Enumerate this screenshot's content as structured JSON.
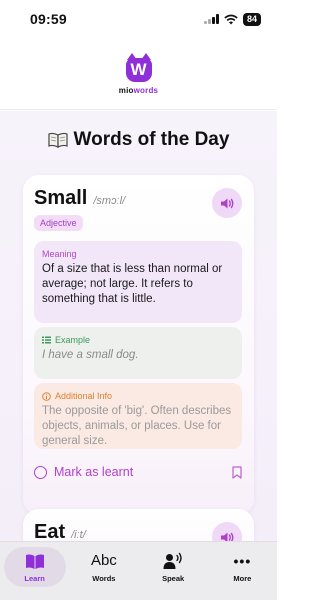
{
  "status": {
    "time": "09:59",
    "battery": "84"
  },
  "header": {
    "logo_letter": "W",
    "logo_prefix": "mio",
    "logo_suffix": "words"
  },
  "page_title": "Words of the Day",
  "cards": [
    {
      "word": "Small",
      "phonetic": "/smɔːl/",
      "part_of_speech": "Adjective",
      "meaning_label": "Meaning",
      "meaning": "Of a size that is less than normal or average; not large. It refers to something that is little.",
      "example_label": "Example",
      "example": "I have a small dog.",
      "info_label": "Additional Info",
      "info": "The opposite of 'big'. Often describes objects, animals, or places. Use for general size.",
      "mark_label": "Mark as learnt"
    },
    {
      "word": "Eat",
      "phonetic": "/iːt/"
    }
  ],
  "tabs": [
    {
      "label": "Learn",
      "icon": "book-icon",
      "active": true
    },
    {
      "label": "Words",
      "icon": "abc-icon",
      "icon_text": "Abc",
      "active": false
    },
    {
      "label": "Speak",
      "icon": "speak-icon",
      "active": false
    },
    {
      "label": "More",
      "icon": "more-icon",
      "icon_text": "•••",
      "active": false
    }
  ],
  "colors": {
    "accent": "#8e2fd8",
    "example": "#3a9a5a",
    "info": "#e08030"
  }
}
